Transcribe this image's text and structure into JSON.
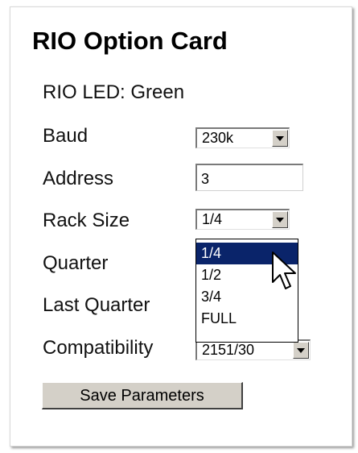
{
  "card": {
    "title": "RIO Option Card"
  },
  "status": {
    "rio_led": "RIO LED: Green"
  },
  "fields": {
    "baud_label": "Baud",
    "baud_value": "230k",
    "address_label": "Address",
    "address_value": "3",
    "rack_size_label": "Rack Size",
    "rack_size_value": "1/4",
    "quarter_label": "Quarter",
    "last_quarter_label": "Last Quarter",
    "compatibility_label": "Compatibility",
    "compatibility_value": "2151/30"
  },
  "rack_size_dropdown": {
    "options": [
      "1/4",
      "1/2",
      "3/4",
      "FULL"
    ],
    "highlighted": "1/4"
  },
  "actions": {
    "save_label": "Save Parameters"
  },
  "icons": {
    "dropdown_arrow": "chevron-down-icon",
    "pointer": "mouse-cursor-icon"
  },
  "colors": {
    "highlight": "#0a246a",
    "button_face": "#d4d0c8"
  }
}
